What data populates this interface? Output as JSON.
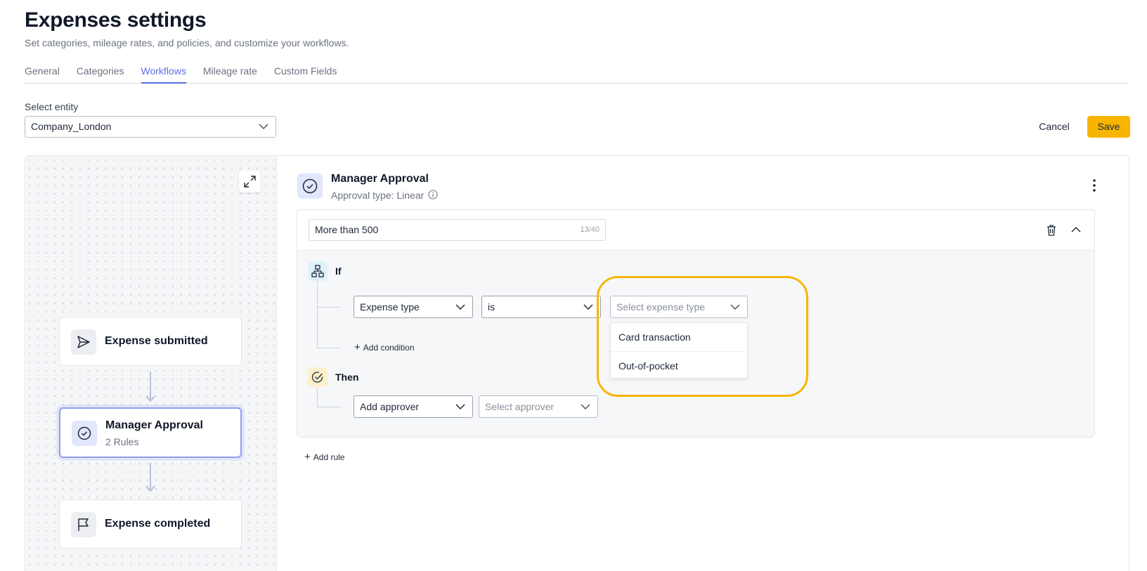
{
  "header": {
    "title": "Expenses settings",
    "subtitle": "Set categories, mileage rates, and policies, and customize your workflows."
  },
  "tabs": [
    {
      "label": "General",
      "active": false
    },
    {
      "label": "Categories",
      "active": false
    },
    {
      "label": "Workflows",
      "active": true
    },
    {
      "label": "Mileage rate",
      "active": false
    },
    {
      "label": "Custom Fields",
      "active": false
    }
  ],
  "entity": {
    "label": "Select entity",
    "value": "Company_London"
  },
  "actions": {
    "cancel_label": "Cancel",
    "save_label": "Save"
  },
  "workflow": {
    "nodes": [
      {
        "title": "Expense submitted",
        "icon": "send-icon"
      },
      {
        "title": "Manager Approval",
        "subtitle": "2 Rules",
        "icon": "check-circle-icon",
        "selected": true
      },
      {
        "title": "Expense completed",
        "icon": "flag-icon"
      }
    ]
  },
  "step": {
    "title": "Manager Approval",
    "subtitle": "Approval type: Linear"
  },
  "rule": {
    "name": "More than 500",
    "char_count": "13/40",
    "if_label": "If",
    "then_label": "Then",
    "condition": {
      "field": "Expense type",
      "operator": "is",
      "value_placeholder": "Select expense type"
    },
    "add_condition_label": "Add condition",
    "action": {
      "type": "Add approver",
      "approver_placeholder": "Select approver"
    },
    "expense_type_options": [
      "Card transaction",
      "Out-of-pocket"
    ]
  },
  "add_rule_label": "Add rule",
  "colors": {
    "accent": "#5b6ee1",
    "save": "#f8b500",
    "highlight": "#f8b500"
  }
}
